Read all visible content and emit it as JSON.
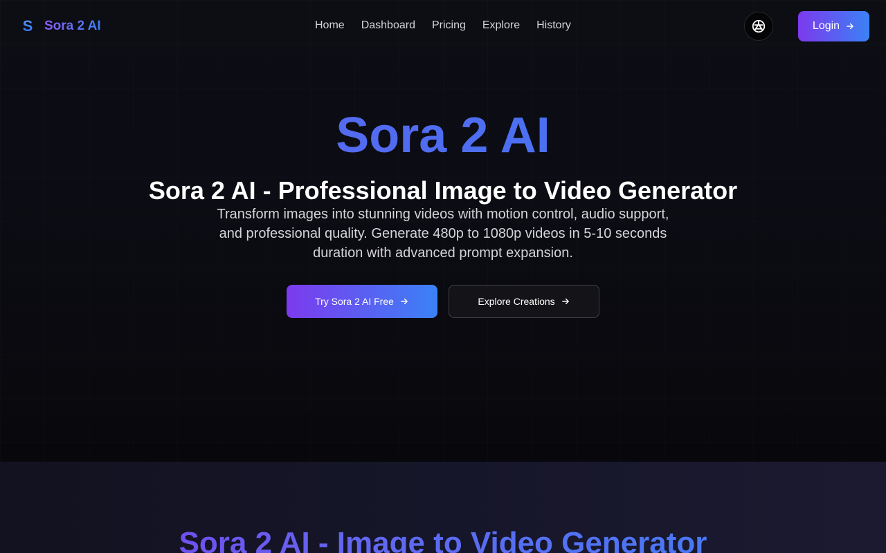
{
  "header": {
    "brand_mark": "S",
    "brand_name": "Sora 2 AI",
    "nav": [
      "Home",
      "Dashboard",
      "Pricing",
      "Explore",
      "History"
    ],
    "theme_icon": "theme-toggle-icon",
    "login_label": "Login"
  },
  "hero": {
    "title": "Sora 2 AI",
    "subtitle": "Sora 2 AI - Professional Image to Video Generator",
    "description": "Transform images into stunning videos with motion control, audio support, and professional quality. Generate 480p to 1080p videos in 5-10 seconds duration with advanced prompt expansion.",
    "primary_cta": "Try Sora 2 AI Free",
    "secondary_cta": "Explore Creations"
  },
  "section2": {
    "title": "Sora 2 AI - Image to Video Generator"
  },
  "colors": {
    "accent_start": "#7c3aed",
    "accent_end": "#3b82f6",
    "background": "#0a0a0f"
  }
}
